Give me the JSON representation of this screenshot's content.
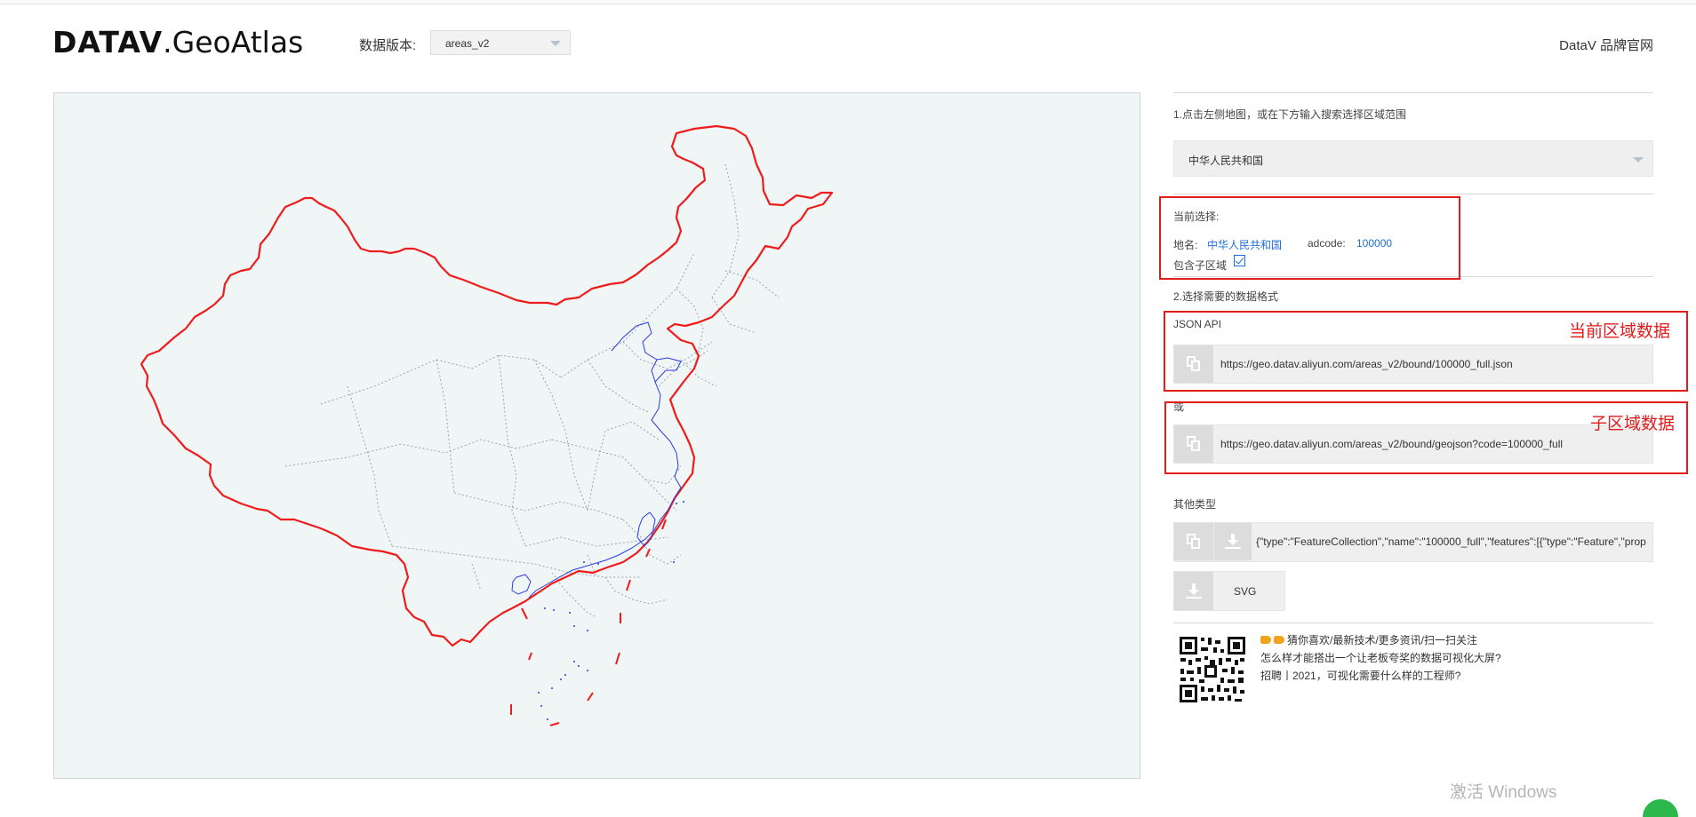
{
  "header": {
    "logo_bold": "DATAV",
    "logo_thin": ".GeoAtlas",
    "version_label": "数据版本:",
    "version_value": "areas_v2",
    "brand_link": "DataV 品牌官网"
  },
  "panel": {
    "step1_hint": "1.点击左侧地图，或在下方输入搜索选择区域范围",
    "region_value": "中华人民共和国",
    "current_selection_label": "当前选择:",
    "place_label": "地名:",
    "place_value": "中华人民共和国",
    "adcode_label": "adcode:",
    "adcode_value": "100000",
    "include_sub_label": "包含子区域",
    "include_sub_checked": true,
    "step2_hint": "2.选择需要的数据格式",
    "json_api_label": "JSON API",
    "json_api_url": "https://geo.datav.aliyun.com/areas_v2/bound/100000_full.json",
    "or_label": "或",
    "geojson_url": "https://geo.datav.aliyun.com/areas_v2/bound/geojson?code=100000_full",
    "other_types_label": "其他类型",
    "raw_json_preview": "{\"type\":\"FeatureCollection\",\"name\":\"100000_full\",\"features\":[{\"type\":\"Feature\",\"prop",
    "svg_button_label": "SVG"
  },
  "annotations": {
    "current_area_data": "当前区域数据",
    "sub_area_data": "子区域数据"
  },
  "news": {
    "line1": "猜你喜欢/最新技术/更多资讯/扫一扫关注",
    "line2": "怎么样才能搭出一个让老板夸奖的数据可视化大屏?",
    "line3": "招聘丨2021，可视化需要什么样的工程师?"
  },
  "watermark": "激活 Windows",
  "colors": {
    "annotation_red": "#e21b1b",
    "link_blue": "#1f6fdf",
    "map_bg": "#f0f5f5",
    "border_red": "#ee1c1c",
    "coast_blue": "#2a3ce0"
  }
}
